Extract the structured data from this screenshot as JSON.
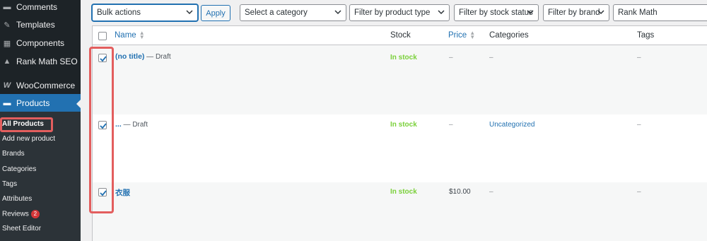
{
  "sidebar": {
    "menu": [
      {
        "label": "Comments",
        "icon": "comments-icon"
      },
      {
        "label": "Templates",
        "icon": "templates-icon"
      },
      {
        "label": "Components",
        "icon": "components-icon"
      },
      {
        "label": "Rank Math SEO",
        "icon": "rank-math-icon"
      },
      {
        "label": "WooCommerce",
        "icon": "woocommerce-icon"
      },
      {
        "label": "Products",
        "icon": "products-icon"
      }
    ],
    "submenu": [
      {
        "label": "All Products"
      },
      {
        "label": "Add new product"
      },
      {
        "label": "Brands"
      },
      {
        "label": "Categories"
      },
      {
        "label": "Tags"
      },
      {
        "label": "Attributes"
      },
      {
        "label": "Reviews",
        "badge": "2"
      },
      {
        "label": "Sheet Editor"
      }
    ]
  },
  "toolbar": {
    "bulk_actions": "Bulk actions",
    "apply": "Apply",
    "category": "Select a category",
    "product_type": "Filter by product type",
    "stock_status": "Filter by stock status",
    "brand": "Filter by brand",
    "rank_math": "Rank Math"
  },
  "table": {
    "columns": {
      "name": "Name",
      "stock": "Stock",
      "price": "Price",
      "categories": "Categories",
      "tags": "Tags"
    },
    "rows": [
      {
        "title": "(no title)",
        "state": " — Draft",
        "stock": "In stock",
        "price": "–",
        "categories": "–",
        "tags": "–",
        "checked": true
      },
      {
        "title": "...",
        "state": " — Draft",
        "stock": "In stock",
        "price": "–",
        "categories": "Uncategorized",
        "tags": "–",
        "checked": true
      },
      {
        "title": "衣服",
        "state": "",
        "stock": "In stock",
        "price": "$10.00",
        "categories": "–",
        "tags": "–",
        "checked": true
      }
    ]
  },
  "colors": {
    "sidebar_bg": "#1d2327",
    "accent": "#2271b1",
    "in_stock": "#7ad03a",
    "highlight": "#e35e5e",
    "badge": "#d63638"
  }
}
